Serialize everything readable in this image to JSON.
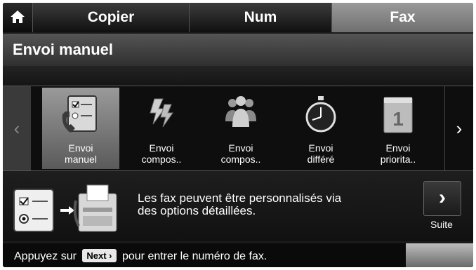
{
  "tabs": [
    {
      "label": "Copier"
    },
    {
      "label": "Num"
    },
    {
      "label": "Fax",
      "active": true
    }
  ],
  "header": {
    "title": "Envoi manuel"
  },
  "carousel": {
    "items": [
      {
        "line1": "Envoi",
        "line2": "manuel",
        "icon": "manual-send-icon",
        "selected": true
      },
      {
        "line1": "Envoi",
        "line2": "compos..",
        "icon": "speed-dial-icon"
      },
      {
        "line1": "Envoi",
        "line2": "compos..",
        "icon": "group-dial-icon"
      },
      {
        "line1": "Envoi",
        "line2": "différé",
        "icon": "delayed-send-icon"
      },
      {
        "line1": "Envoi",
        "line2": "priorita..",
        "icon": "priority-send-icon"
      }
    ]
  },
  "info": {
    "text_line1": "Les fax peuvent être personnalisés via",
    "text_line2": "des options détaillées.",
    "suite_label": "Suite"
  },
  "status": {
    "prefix": "Appuyez sur",
    "key": "Next ›",
    "suffix": "pour entrer le numéro de fax."
  },
  "colors": {
    "background": "#1b1b1b",
    "active_tab": "#8a8a8a",
    "text": "#ffffff"
  }
}
